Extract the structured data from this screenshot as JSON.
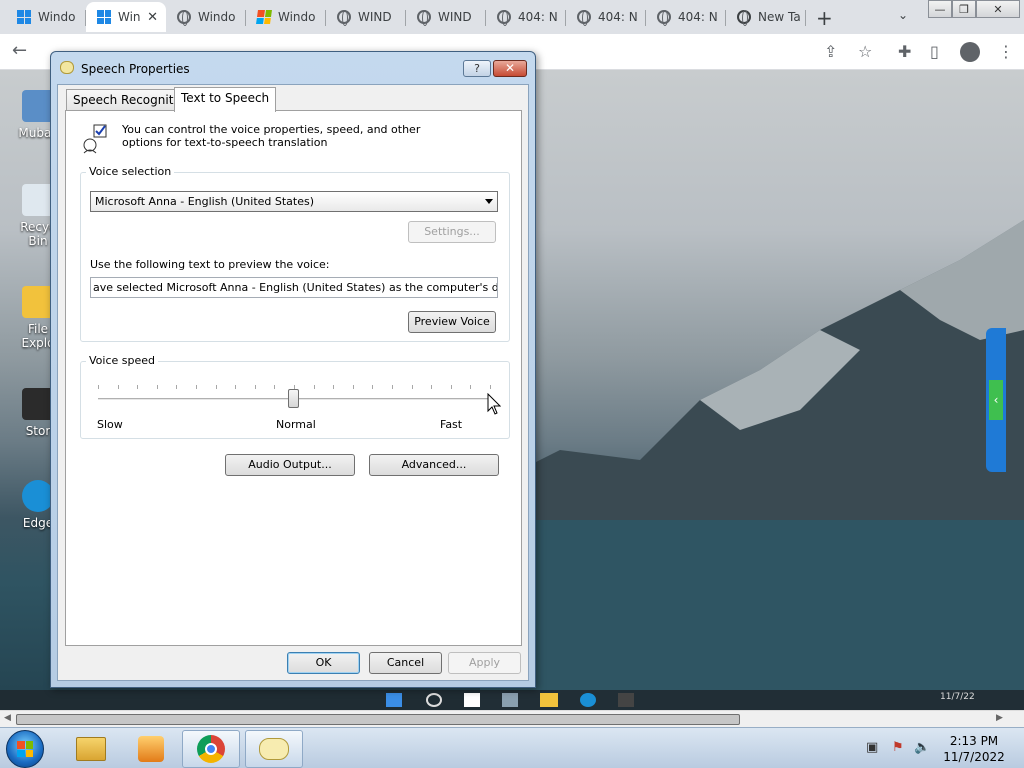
{
  "browser": {
    "tabs": [
      {
        "label": "Windo",
        "icon": "windows-icon"
      },
      {
        "label": "Win",
        "icon": "windows-icon"
      },
      {
        "label": "Windo",
        "icon": "globe-icon"
      },
      {
        "label": "Windo",
        "icon": "windows-xp-icon"
      },
      {
        "label": "WIND",
        "icon": "globe-icon"
      },
      {
        "label": "WIND",
        "icon": "globe-icon"
      },
      {
        "label": "404: N",
        "icon": "globe-icon"
      },
      {
        "label": "404: N",
        "icon": "globe-icon"
      },
      {
        "label": "404: N",
        "icon": "globe-icon"
      },
      {
        "label": "New Ta",
        "icon": "chrome-icon"
      }
    ]
  },
  "desktop": {
    "icons": [
      {
        "label": "Mubas"
      },
      {
        "label": "Recyc\nBin"
      },
      {
        "label": "File\nExplo"
      },
      {
        "label": "Stor"
      },
      {
        "label": "Edge"
      }
    ],
    "inner_clock": "11/7/22"
  },
  "dialog": {
    "title": "Speech Properties",
    "help_label": "?",
    "close_label": "✕",
    "tabs": {
      "speech_recognition": "Speech Recognition",
      "text_to_speech": "Text to Speech"
    },
    "message": "You can control the voice properties, speed, and other options for text-to-speech translation",
    "voice_selection": {
      "group_label": "Voice selection",
      "selected_voice": "Microsoft Anna - English (United States)",
      "settings_button": "Settings...",
      "preview_label": "Use the following text to preview the voice:",
      "preview_text": "ave selected Microsoft Anna - English (United States) as the computer's default voice.",
      "preview_button": "Preview Voice"
    },
    "voice_speed": {
      "group_label": "Voice speed",
      "slow_label": "Slow",
      "normal_label": "Normal",
      "fast_label": "Fast",
      "level": 0.5
    },
    "audio_output_button": "Audio Output...",
    "advanced_button": "Advanced...",
    "ok_button": "OK",
    "cancel_button": "Cancel",
    "apply_button": "Apply"
  },
  "taskbar": {
    "time": "2:13 PM",
    "date": "11/7/2022"
  }
}
